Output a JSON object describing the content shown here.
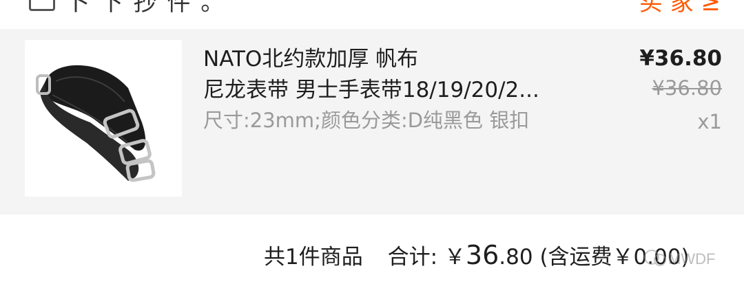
{
  "top": {
    "shop_fragment": "卜 下 抄 件 。",
    "status_fragment": "买 家 ≥"
  },
  "item": {
    "title_line1": "NATO北约款加厚 帆布",
    "title_line2": "尼龙表带 男士手表带18/19/20/2...",
    "spec": "尺寸:23mm;颜色分类:D纯黑色 银扣",
    "price_now": "¥36.80",
    "price_old": "¥36.80",
    "quantity": "x1",
    "image_icon": "watch-strap-image"
  },
  "summary": {
    "count_text": "共1件商品",
    "total_label": "合计: ￥",
    "total_int": "36",
    "total_dec": ".80",
    "shipping_text": "(含运费￥0.00)"
  },
  "watermark": {
    "text": "MWDF"
  }
}
